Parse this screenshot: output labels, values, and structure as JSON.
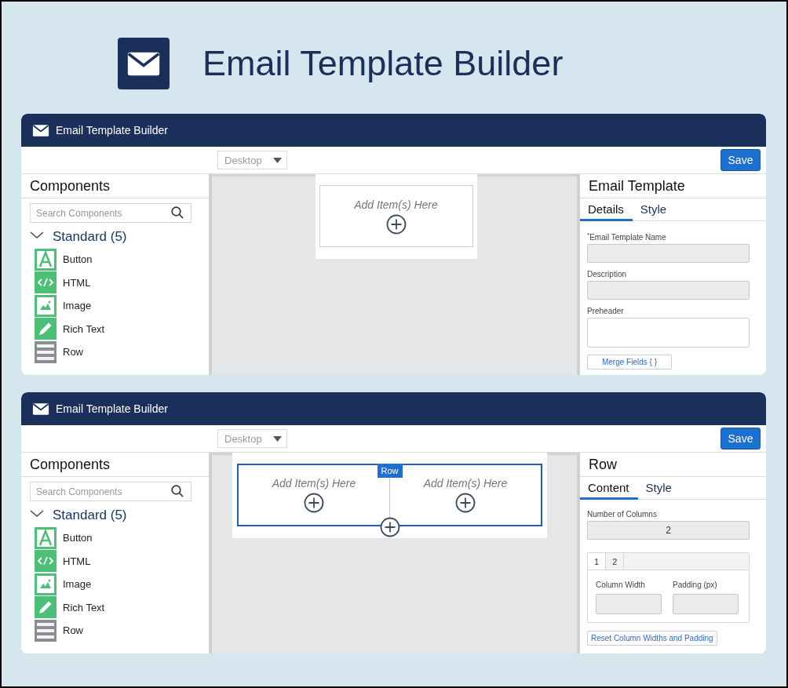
{
  "header": {
    "title": "Email Template Builder"
  },
  "builders": [
    {
      "app_title": "Email Template Builder",
      "device": "Desktop",
      "save": "Save",
      "components": {
        "title": "Components",
        "search_placeholder": "Search Components",
        "group": {
          "label": "Standard (5)",
          "expanded": true,
          "items": [
            {
              "label": "Button",
              "kind": "button"
            },
            {
              "label": "HTML",
              "kind": "html"
            },
            {
              "label": "Image",
              "kind": "image"
            },
            {
              "label": "Rich Text",
              "kind": "richtext"
            },
            {
              "label": "Row",
              "kind": "row"
            }
          ]
        }
      },
      "canvas": {
        "kind": "single",
        "zones": [
          "Add Item(s) Here"
        ]
      },
      "properties": {
        "title": "Email Template",
        "tabs": [
          {
            "label": "Details",
            "selected": true
          },
          {
            "label": "Style",
            "selected": false
          }
        ],
        "fields": [
          {
            "kind": "text",
            "label": "$^{*}$Email Template Name"
          },
          {
            "kind": "text",
            "label": "Description"
          },
          {
            "kind": "textarea",
            "label": "Preheader"
          },
          {
            "kind": "button",
            "label": "Merge Fields { }"
          }
        ]
      }
    },
    {
      "app_title": "Email Template Builder",
      "device": "Desktop",
      "save": "Save",
      "components": {
        "title": "Components",
        "search_placeholder": "Search Components",
        "group": {
          "label": "Standard (5)",
          "expanded": true,
          "items": [
            {
              "label": "Button",
              "kind": "button"
            },
            {
              "label": "HTML",
              "kind": "html"
            },
            {
              "label": "Image",
              "kind": "image"
            },
            {
              "label": "Rich Text",
              "kind": "richtext"
            },
            {
              "label": "Row",
              "kind": "row"
            }
          ]
        }
      },
      "canvas": {
        "kind": "row",
        "badge": "Row",
        "selected": true,
        "zones": [
          "Add Item(s) Here",
          "Add Item(s) Here"
        ]
      },
      "properties": {
        "title": "Row",
        "tabs": [
          {
            "label": "Content",
            "selected": true
          },
          {
            "label": "Style",
            "selected": false
          }
        ],
        "fields": [
          {
            "kind": "text",
            "label": "Number of Columns",
            "value": "2"
          },
          {
            "kind": "columns",
            "tabs": [
              {
                "label": "1",
                "selected": true
              },
              {
                "label": "2",
                "selected": false
              }
            ],
            "fields": [
              {
                "label": "Column Width"
              },
              {
                "label": "Padding (px)"
              }
            ]
          },
          {
            "kind": "button",
            "label": "Reset Column Widths and Padding"
          }
        ]
      }
    }
  ]
}
